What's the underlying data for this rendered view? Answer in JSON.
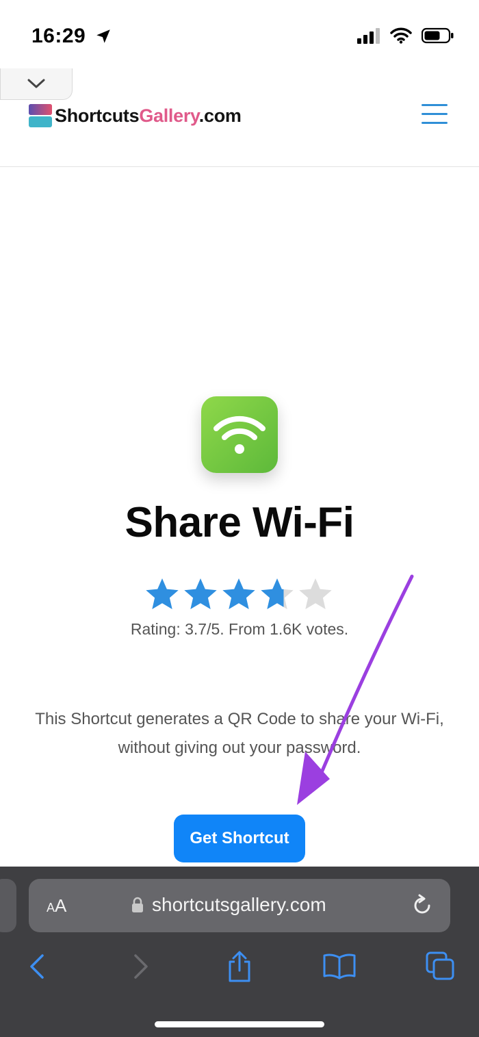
{
  "status_bar": {
    "time": "16:29"
  },
  "header": {
    "logo_part1": "Shortcuts",
    "logo_part2": "Gallery",
    "logo_part3": ".com"
  },
  "shortcut": {
    "title": "Share Wi-Fi",
    "rating_value": 3.7,
    "rating_max": 5,
    "rating_text": "Rating: 3.7/5. From 1.6K votes.",
    "description": "This Shortcut generates a QR Code to share your Wi-Fi, without giving out your password.",
    "button_label": "Get Shortcut",
    "icon": "wifi-icon",
    "icon_color": "#6cc83e"
  },
  "colors": {
    "accent": "#1085f8",
    "star_filled": "#2f8fe0",
    "star_empty": "#dcdcdc",
    "annotation_arrow": "#9b3fe0",
    "toolbar_bg": "#3f3f42"
  },
  "safari": {
    "aa_label_small": "A",
    "aa_label_large": "A",
    "url": "shortcutsgallery.com"
  }
}
